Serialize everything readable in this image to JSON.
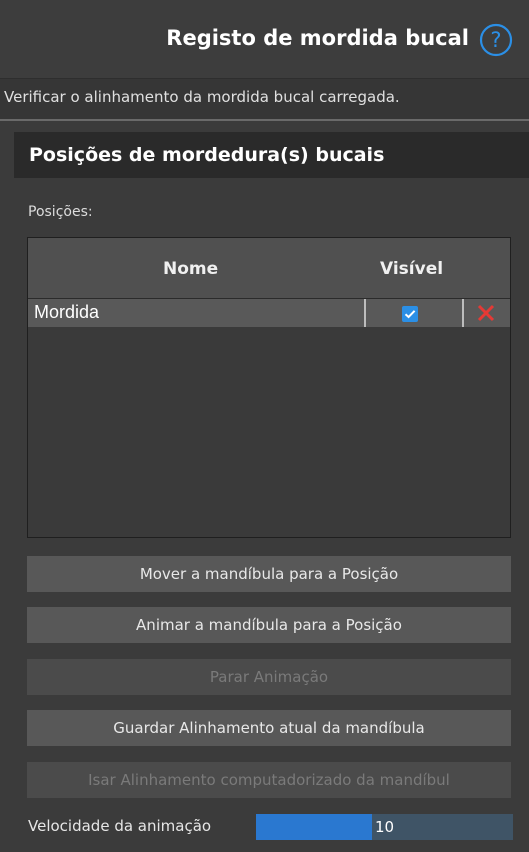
{
  "header": {
    "title": "Registo de mordida bucal",
    "help_icon": "question-circle-icon"
  },
  "description": "Verificar o alinhamento da mordida bucal carregada.",
  "section": {
    "title": "Posições de mordedura(s) bucais"
  },
  "positions_label": "Posições:",
  "table": {
    "columns": [
      "Nome",
      "Visível"
    ],
    "rows": [
      {
        "name": "Mordida",
        "visible": true
      }
    ]
  },
  "buttons": {
    "move": "Mover a mandíbula para a Posição",
    "animate": "Animar a mandíbula para a Posição",
    "stop": "Parar Animação",
    "save": "Guardar Alinhamento atual da mandíbula",
    "use": "Isar Alinhamento computadorizado da mandíbul"
  },
  "speed": {
    "label": "Velocidade da animação",
    "value": "10",
    "fill_fraction": 0.45
  },
  "colors": {
    "accent": "#2a78d0",
    "checkbox": "#2b8fe6",
    "delete": "#e53935",
    "help": "#2b8fe6"
  }
}
